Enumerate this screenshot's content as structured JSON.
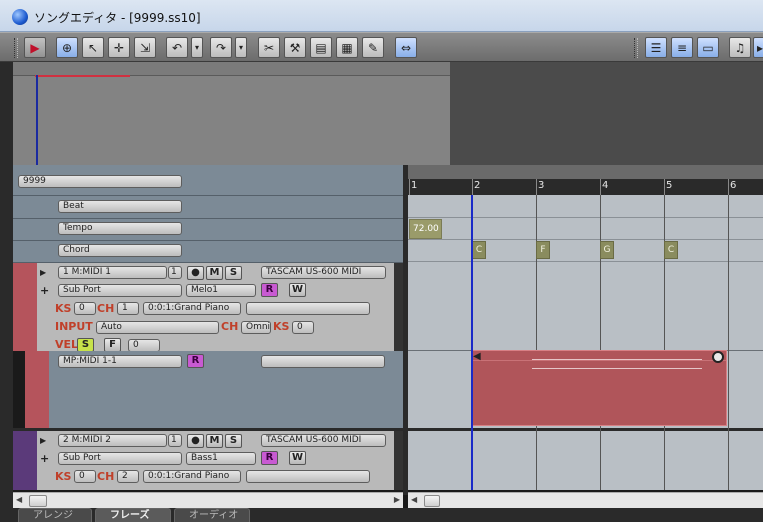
{
  "window": {
    "title": "ソングエディタ - [9999.ss10]"
  },
  "toolbar": {
    "icons": [
      "play-record",
      "add-track",
      "pointer",
      "add-pointer",
      "range-select",
      "undo",
      "dropdown",
      "redo",
      "dropdown",
      "scissors",
      "glue",
      "quantize",
      "piano-roll",
      "eraser",
      "marker",
      "list-view",
      "mixer",
      "window",
      "score"
    ]
  },
  "song": {
    "name": "9999"
  },
  "system_tracks": [
    {
      "label": "Beat"
    },
    {
      "label": "Tempo"
    },
    {
      "label": "Chord"
    }
  ],
  "tracks": [
    {
      "name": "1 M:MIDI 1",
      "number": "1",
      "mute": "M",
      "solo": "S",
      "device": "TASCAM US-600 MIDI",
      "port": "Sub Port",
      "part": "Melo1",
      "read": "R",
      "write": "W",
      "ks_label": "KS",
      "ks": "0",
      "ch_label": "CH",
      "ch": "1",
      "instrument": "0:0:1:Grand Piano",
      "input_label": "INPUT",
      "input": "Auto",
      "input_ch": "Omni",
      "input_ks": "0",
      "vel_label": "VEL",
      "vel_s": "S",
      "vel_f": "F",
      "vel": "0",
      "color": "#b5545c"
    },
    {
      "name": "MP:MIDI 1-1",
      "read": "R",
      "color": "#b5545c"
    },
    {
      "name": "2 M:MIDI 2",
      "number": "1",
      "mute": "M",
      "solo": "S",
      "device": "TASCAM US-600 MIDI",
      "port": "Sub Port",
      "part": "Bass1",
      "read": "R",
      "write": "W",
      "ks_label": "KS",
      "ks": "0",
      "ch_label": "CH",
      "ch": "2",
      "instrument": "0:0:1:Grand Piano",
      "color": "#5b3a7a"
    }
  ],
  "ruler": {
    "bars": [
      "1",
      "2",
      "3",
      "4",
      "5",
      "6"
    ]
  },
  "tempo_track": {
    "value": "72.00"
  },
  "chord_track": {
    "chords": [
      "C",
      "F",
      "G",
      "C"
    ]
  },
  "tabs": [
    {
      "label": "アレンジ",
      "active": false
    },
    {
      "label": "フレーズ",
      "active": true
    },
    {
      "label": "オーディオ",
      "active": false
    }
  ],
  "colors": {
    "record": "#c0102a",
    "cursor": "#1a2ac8",
    "part_clip": "#b0555a",
    "read_button": "#c85ad2",
    "solo_button": "#c7e24a"
  }
}
